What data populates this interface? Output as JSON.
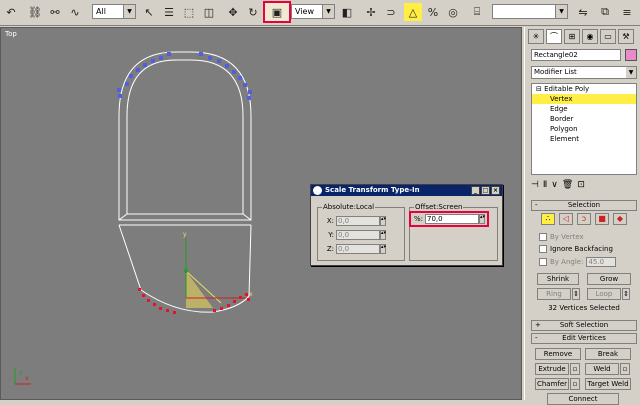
{
  "toolbar": {
    "selection_filter": "All",
    "reference_coord": "View",
    "named_selection": ""
  },
  "viewport": {
    "label": "Top"
  },
  "panel": {
    "object_name": "Rectangle02",
    "modifier_list": "Modifier List",
    "stack": [
      {
        "label": "Editable Poly"
      },
      {
        "label": "Vertex"
      },
      {
        "label": "Edge"
      },
      {
        "label": "Border"
      },
      {
        "label": "Polygon"
      },
      {
        "label": "Element"
      }
    ],
    "selection_title": "Selection",
    "by_vertex": "By Vertex",
    "ignore_backfacing": "Ignore Backfacing",
    "by_angle": "By Angle:",
    "by_angle_value": "45.0",
    "shrink": "Shrink",
    "grow": "Grow",
    "ring": "Ring",
    "loop": "Loop",
    "selection_info": "32 Vertices Selected",
    "soft_selection": "Soft Selection",
    "edit_vertices": "Edit Vertices",
    "remove": "Remove",
    "break": "Break",
    "extrude": "Extrude",
    "weld": "Weld",
    "chamfer": "Chamfer",
    "target_weld": "Target Weld",
    "connect": "Connect"
  },
  "dialog": {
    "title": "Scale Transform Type-In",
    "absolute_label": "Absolute:Local",
    "offset_label": "Offset:Screen",
    "x_label": "X:",
    "y_label": "Y:",
    "z_label": "Z:",
    "x_value": "0,0",
    "y_value": "0,0",
    "z_value": "0,0",
    "pct_label": "%:",
    "pct_value": "70,0"
  },
  "colors": {
    "viewport_bg": "#7d7d7d",
    "highlight": "#e8003a",
    "selected_stack": "#ffee44",
    "top_vertices": "#5060e0",
    "selected_vertices": "#e8102a"
  }
}
